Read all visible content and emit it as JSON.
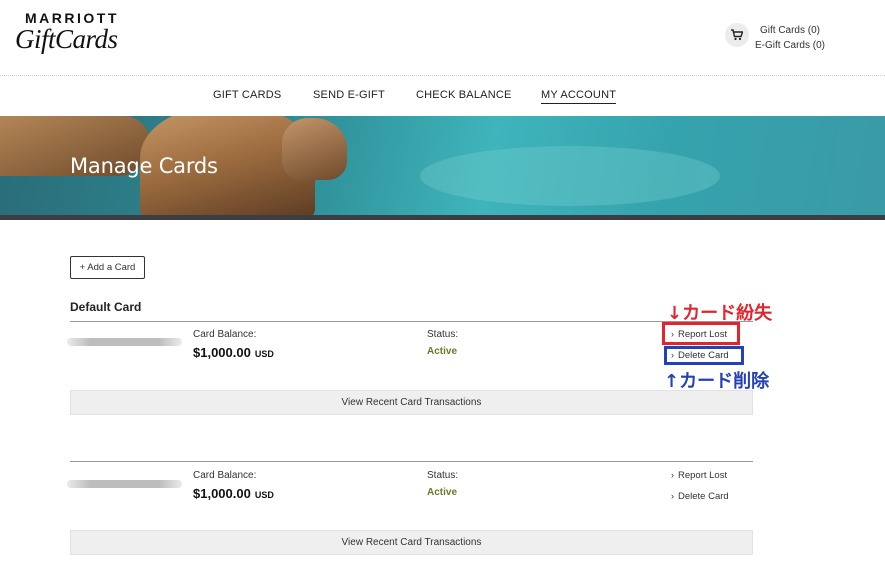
{
  "brand": {
    "top": "MARRIOTT",
    "script": "GiftCards"
  },
  "cart": {
    "gift_cards": "Gift Cards (0)",
    "egift_cards": "E-Gift Cards (0)"
  },
  "nav": {
    "items": [
      {
        "label": "GIFT CARDS"
      },
      {
        "label": "SEND E-GIFT"
      },
      {
        "label": "CHECK BALANCE"
      },
      {
        "label": "MY ACCOUNT",
        "active": true
      }
    ]
  },
  "hero": {
    "title": "Manage Cards"
  },
  "main": {
    "add_card_label": "+ Add a Card",
    "default_section_title": "Default Card",
    "cards": [
      {
        "balance_label": "Card Balance:",
        "balance_amount": "$1,000.00",
        "currency": "USD",
        "status_label": "Status:",
        "status_value": "Active",
        "report_lost_label": "Report Lost",
        "delete_card_label": "Delete Card",
        "view_transactions_label": "View Recent Card Transactions"
      },
      {
        "balance_label": "Card Balance:",
        "balance_amount": "$1,000.00",
        "currency": "USD",
        "status_label": "Status:",
        "status_value": "Active",
        "report_lost_label": "Report Lost",
        "delete_card_label": "Delete Card",
        "view_transactions_label": "View Recent Card Transactions"
      }
    ]
  },
  "annotations": {
    "report_lost": "↓カード紛失",
    "delete_card": "↑カード削除"
  },
  "colors": {
    "active_status": "#6a7a2a",
    "annotation_red": "#e0262c",
    "annotation_blue": "#2442b8"
  }
}
